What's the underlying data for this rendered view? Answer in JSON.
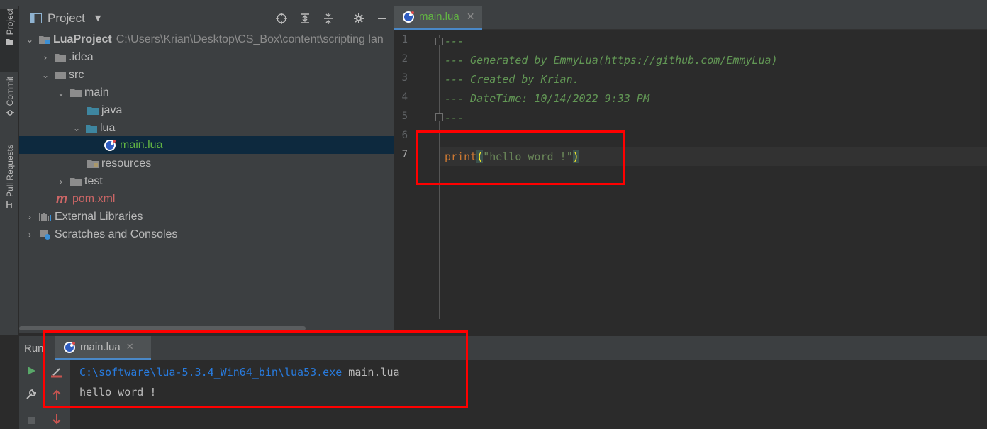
{
  "sidebar": {
    "tabs": [
      {
        "label": "Project"
      },
      {
        "label": "Commit"
      },
      {
        "label": "Pull Requests"
      }
    ]
  },
  "project_panel": {
    "title": "Project",
    "tree": [
      {
        "label": "LuaProject",
        "path": "C:\\Users\\Krian\\Desktop\\CS_Box\\content\\scripting lan"
      },
      {
        "label": ".idea"
      },
      {
        "label": "src"
      },
      {
        "label": "main"
      },
      {
        "label": "java"
      },
      {
        "label": "lua"
      },
      {
        "label": "main.lua"
      },
      {
        "label": "resources"
      },
      {
        "label": "test"
      },
      {
        "label": "pom.xml"
      },
      {
        "label": "External Libraries"
      },
      {
        "label": "Scratches and Consoles"
      }
    ]
  },
  "editor": {
    "tab_label": "main.lua",
    "line_numbers": [
      "1",
      "2",
      "3",
      "4",
      "5",
      "6",
      "7"
    ],
    "lines": [
      "---",
      "--- Generated by EmmyLua(https://github.com/EmmyLua)",
      "--- Created by Krian.",
      "--- DateTime: 10/14/2022 9:33 PM",
      "---",
      "",
      ""
    ],
    "code": {
      "fn": "print",
      "open": "(",
      "str": "\"hello word !\"",
      "close": ")"
    }
  },
  "run": {
    "label": "Run",
    "tab_label": "main.lua",
    "console": {
      "exe_path": "C:\\software\\lua-5.3.4_Win64_bin\\lua53.exe",
      "arg": " main.lua",
      "output": "hello word !"
    }
  },
  "colors": {
    "highlight_box": "#ff0000",
    "accent": "#4a88c7",
    "lua_file": "#62b543"
  }
}
